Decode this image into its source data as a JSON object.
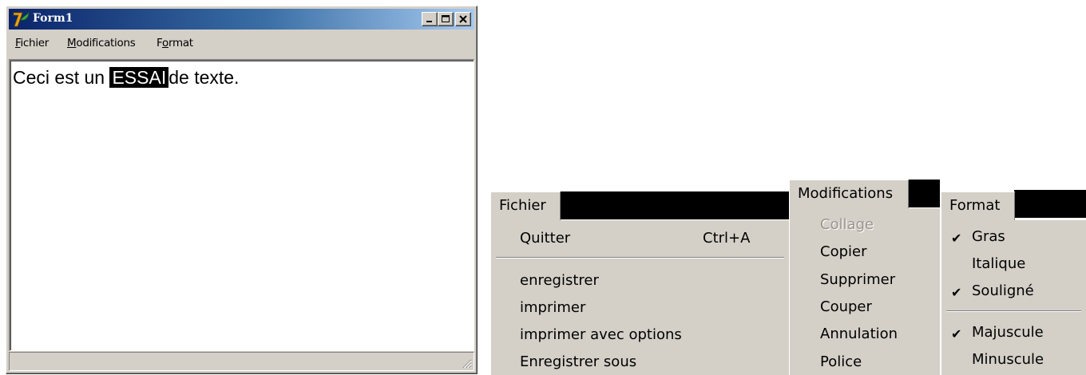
{
  "window": {
    "title": "Form1",
    "icons": {
      "app": "delphi-icon",
      "minimize": "minimize-icon",
      "maximize": "maximize-icon",
      "close": "close-icon"
    },
    "menubar": {
      "fichier": {
        "accel": "F",
        "rest": "ichier"
      },
      "modifications": {
        "accel": "M",
        "rest": "odifications"
      },
      "format": {
        "pre": "F",
        "accel": "o",
        "rest": "rmat"
      }
    },
    "editor": {
      "before": "Ceci est un ",
      "selected": "ESSAI",
      "after": "de texte."
    }
  },
  "menus": {
    "fichier": {
      "label": "Fichier",
      "items": [
        {
          "label": "Quitter",
          "shortcut": "Ctrl+A"
        },
        {
          "label": "enregistrer"
        },
        {
          "label": "imprimer"
        },
        {
          "label": "imprimer avec options"
        },
        {
          "label": "Enregistrer sous"
        }
      ]
    },
    "modifications": {
      "label": "Modifications",
      "items": [
        {
          "label": "Collage",
          "disabled": true
        },
        {
          "label": "Copier"
        },
        {
          "label": "Supprimer"
        },
        {
          "label": "Couper"
        },
        {
          "label": "Annulation"
        },
        {
          "label": "Police"
        }
      ]
    },
    "format": {
      "label": "Format",
      "items": [
        {
          "label": "Gras",
          "checked": true
        },
        {
          "label": "Italique",
          "checked": false
        },
        {
          "label": "Souligné",
          "checked": true
        },
        {
          "label": "Majuscule",
          "checked": true
        },
        {
          "label": "Minuscule",
          "checked": false
        }
      ],
      "check_glyph": "✔"
    }
  },
  "colors": {
    "face": "#d4d0c8",
    "title_start": "#0a246a",
    "title_end": "#a6caf0",
    "selection": "#000000"
  }
}
